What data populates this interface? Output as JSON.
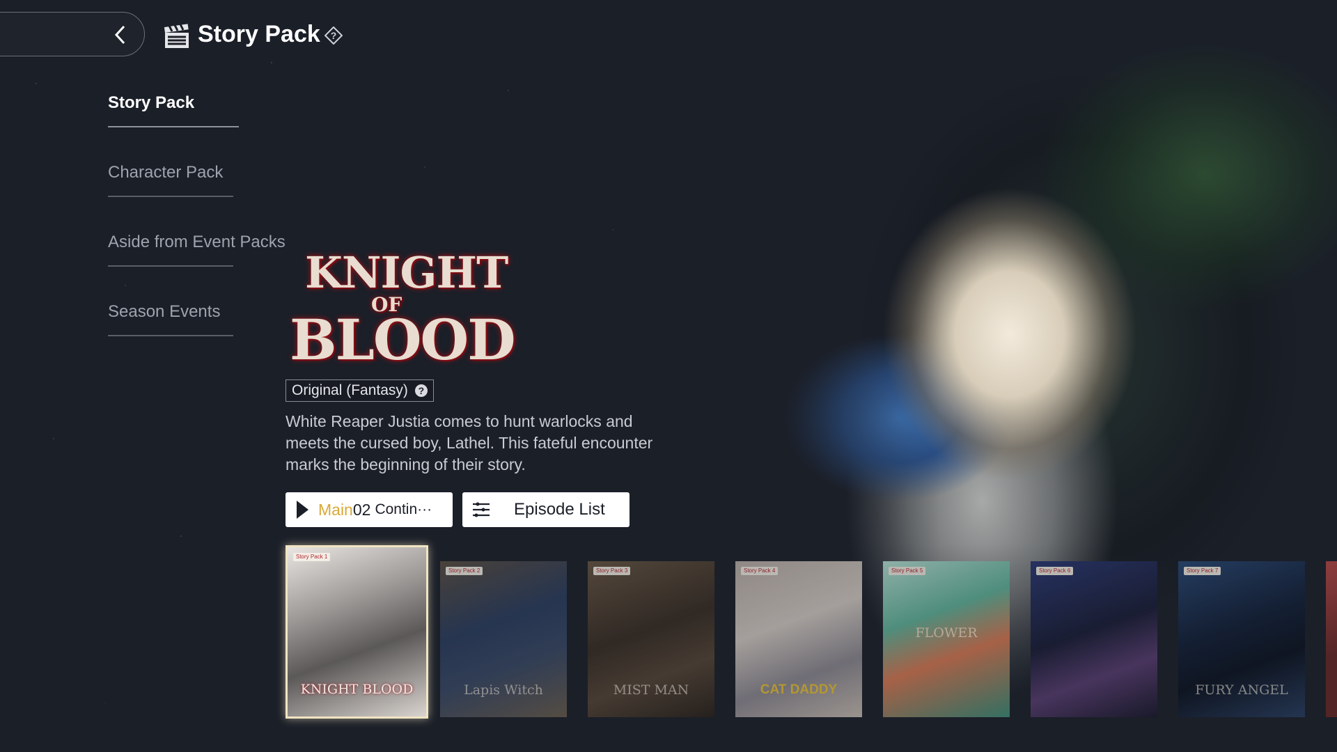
{
  "header": {
    "title": "Story Pack"
  },
  "side_nav": {
    "items": [
      {
        "label": "Story Pack",
        "active": true
      },
      {
        "label": "Character Pack",
        "active": false
      },
      {
        "label": "Aside from Event Packs",
        "active": false
      },
      {
        "label": "Season Events",
        "active": false
      }
    ]
  },
  "featured": {
    "logo": {
      "line1": "KNIGHT",
      "line2": "OF",
      "line3": "BLOOD"
    },
    "genre": "Original (Fantasy)",
    "description": "White Reaper Justia comes to hunt warlocks and meets the cursed boy, Lathel. This fateful encounter marks the beginning of their story.",
    "continue_button": {
      "main": "Main",
      "number": "02",
      "label": "Contin···"
    },
    "episode_list_button": {
      "label": "Episode List"
    }
  },
  "packs": [
    {
      "badge": "Story Pack 1",
      "title": "KNIGHT BLOOD",
      "selected": true
    },
    {
      "badge": "Story Pack 2",
      "title": "Lapis Witch"
    },
    {
      "badge": "Story Pack 3",
      "title": "MIST MAN"
    },
    {
      "badge": "Story Pack 4",
      "title": "CAT DADDY"
    },
    {
      "badge": "Story Pack 5",
      "title": "FLOWER"
    },
    {
      "badge": "Story Pack 6",
      "title": ""
    },
    {
      "badge": "Story Pack 7",
      "title": "FURY ANGEL"
    }
  ],
  "colors": {
    "background": "#1b1f28",
    "accent_gold": "#d9a93a",
    "selected_border": "#f0e4c2"
  }
}
